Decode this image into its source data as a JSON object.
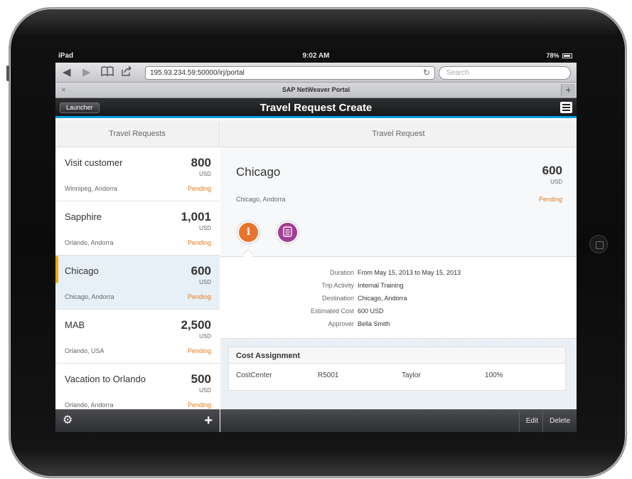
{
  "status_bar": {
    "device": "iPad",
    "time": "9:02 AM",
    "battery": "78%"
  },
  "browser": {
    "url": "195.93.234.59:50000/irj/portal",
    "search_placeholder": "Search",
    "tab_title": "SAP NetWeaver Portal"
  },
  "app": {
    "launcher_label": "Launcher",
    "title": "Travel Request Create"
  },
  "master": {
    "header": "Travel Requests",
    "items": [
      {
        "title": "Visit customer",
        "amount": "800",
        "currency": "USD",
        "location": "Winnipeg, Andorra",
        "status": "Pending"
      },
      {
        "title": "Sapphire",
        "amount": "1,001",
        "currency": "USD",
        "location": "Orlando, Andorra",
        "status": "Pending"
      },
      {
        "title": "Chicago",
        "amount": "600",
        "currency": "USD",
        "location": "Chicago, Andorra",
        "status": "Pending"
      },
      {
        "title": "MAB",
        "amount": "2,500",
        "currency": "USD",
        "location": "Orlando, USA",
        "status": "Pending"
      },
      {
        "title": "Vacation to Orlando",
        "amount": "500",
        "currency": "USD",
        "location": "Orlando, Andorra",
        "status": "Pending"
      }
    ],
    "selected_index": 2
  },
  "detail": {
    "header": "Travel Request",
    "title": "Chicago",
    "amount": "600",
    "currency": "USD",
    "location": "Chicago, Andorra",
    "status": "Pending",
    "fields": [
      {
        "label": "Duration",
        "value": "From May 15, 2013 to May 15, 2013"
      },
      {
        "label": "Trip Activity",
        "value": "Internal Training"
      },
      {
        "label": "Destination",
        "value": "Chicago, Andorra"
      },
      {
        "label": "Estimated Cost",
        "value": "600 USD"
      },
      {
        "label": "Approver",
        "value": "Bella Smith"
      }
    ],
    "cost_assignment": {
      "title": "Cost Assignment",
      "row": {
        "type": "CostCenter",
        "code": "R5001",
        "name": "Taylor",
        "percent": "100%"
      }
    },
    "footer": {
      "edit_label": "Edit",
      "delete_label": "Delete"
    }
  },
  "colors": {
    "accent": "#009de0",
    "pending": "#e17b24",
    "selection": "#f0ab00",
    "info_icon": "#e8742e",
    "notes_icon": "#a33d92"
  },
  "icons": [
    "back-icon",
    "forward-icon",
    "bookmarks-icon",
    "share-icon",
    "reload-icon",
    "menu-icon",
    "gear-icon",
    "plus-icon",
    "info-icon",
    "notes-icon"
  ]
}
